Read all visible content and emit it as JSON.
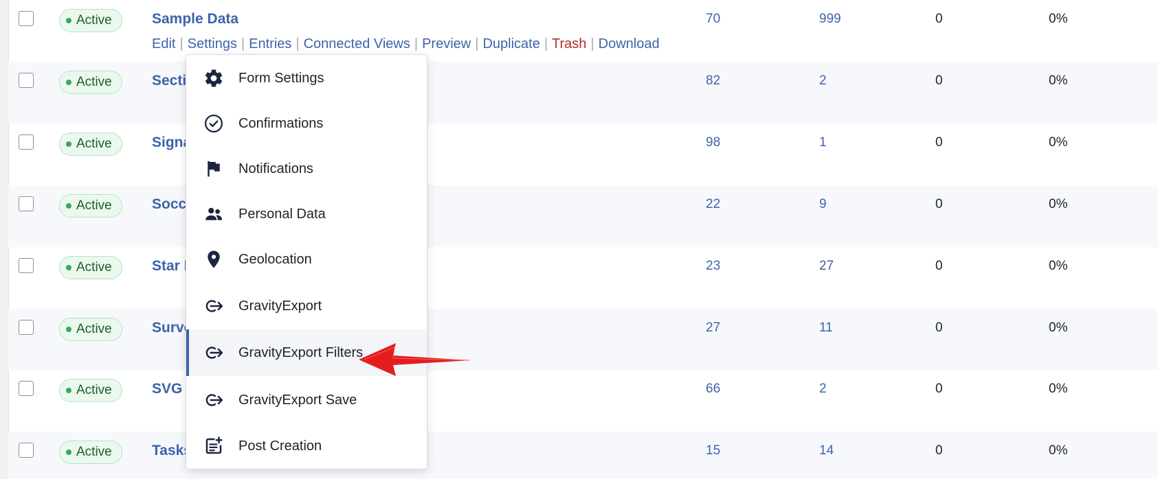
{
  "rows": [
    {
      "status": "Active",
      "title": "Sample Data",
      "id": "70",
      "entries": "999",
      "views": "0",
      "conversion": "0%"
    },
    {
      "status": "Active",
      "title": "Sectio",
      "id": "82",
      "entries": "2",
      "views": "0",
      "conversion": "0%"
    },
    {
      "status": "Active",
      "title": "Signa",
      "id": "98",
      "entries": "1",
      "views": "0",
      "conversion": "0%"
    },
    {
      "status": "Active",
      "title": "Socce",
      "id": "22",
      "entries": "9",
      "views": "0",
      "conversion": "0%"
    },
    {
      "status": "Active",
      "title": "Star F",
      "id": "23",
      "entries": "27",
      "views": "0",
      "conversion": "0%"
    },
    {
      "status": "Active",
      "title": "Surve",
      "id": "27",
      "entries": "11",
      "views": "0",
      "conversion": "0%"
    },
    {
      "status": "Active",
      "title": "SVG f",
      "id": "66",
      "entries": "2",
      "views": "0",
      "conversion": "0%"
    },
    {
      "status": "Active",
      "title": "Tasks",
      "id": "15",
      "entries": "14",
      "views": "0",
      "conversion": "0%"
    }
  ],
  "row_actions": {
    "edit": "Edit",
    "settings": "Settings",
    "entries": "Entries",
    "connected_views": "Connected Views",
    "preview": "Preview",
    "duplicate": "Duplicate",
    "trash": "Trash",
    "download": "Download",
    "separator": "|"
  },
  "settings_menu": {
    "items": [
      {
        "label": "Form Settings",
        "icon": "gear-icon"
      },
      {
        "label": "Confirmations",
        "icon": "check-circle-icon"
      },
      {
        "label": "Notifications",
        "icon": "flag-icon"
      },
      {
        "label": "Personal Data",
        "icon": "users-icon"
      },
      {
        "label": "Geolocation",
        "icon": "map-pin-icon"
      },
      {
        "label": "GravityExport",
        "icon": "export-arrow-icon"
      },
      {
        "label": "GravityExport Filters",
        "icon": "export-arrow-icon",
        "active": true
      },
      {
        "label": "GravityExport Save",
        "icon": "export-arrow-icon"
      },
      {
        "label": "Post Creation",
        "icon": "post-add-icon"
      }
    ]
  },
  "colors": {
    "link": "#3e63a8",
    "trash": "#b32d2e",
    "active_badge_bg": "#ebf8ee",
    "annotation_arrow": "#e31d1d"
  }
}
